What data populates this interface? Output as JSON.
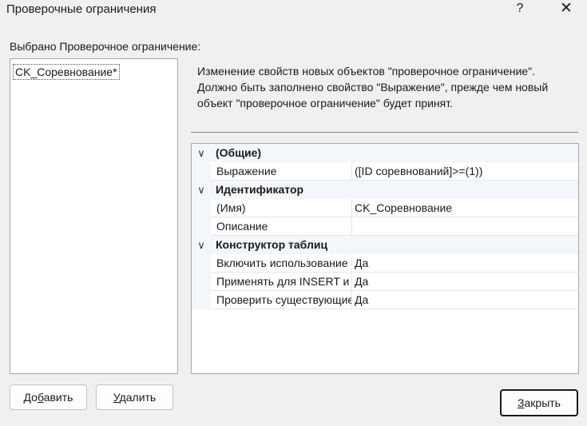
{
  "window": {
    "title": "Проверочные ограничения",
    "help_glyph": "?",
    "close_glyph": "✕"
  },
  "selection": {
    "label": "Выбрано Проверочное ограничение:",
    "items": [
      "CK_Соревнование*"
    ]
  },
  "description": "Изменение свойств новых объектов \"проверочное ограничение\". Должно быть заполнено свойство \"Выражение\", прежде чем новый объект \"проверочное ограничение\" будет принят.",
  "grid": {
    "categories": [
      {
        "label": "(Общие)",
        "properties": [
          {
            "name": "Выражение",
            "value": "([ID соревнований]>=(1))"
          }
        ]
      },
      {
        "label": "Идентификатор",
        "properties": [
          {
            "name": "(Имя)",
            "value": "CK_Соревнование"
          },
          {
            "name": "Описание",
            "value": ""
          }
        ]
      },
      {
        "label": "Конструктор таблиц",
        "properties": [
          {
            "name": "Включить использование",
            "value": "Да"
          },
          {
            "name": "Применять для INSERT и UPDATE",
            "value": "Да"
          },
          {
            "name": "Проверить существующие данные",
            "value": "Да"
          }
        ]
      }
    ],
    "expand_glyph": "∨"
  },
  "buttons": {
    "add": {
      "pre": "До",
      "acc": "б",
      "post": "авить"
    },
    "delete": {
      "pre": "",
      "acc": "У",
      "post": "далить"
    },
    "close": {
      "pre": "",
      "acc": "З",
      "post": "акрыть"
    }
  }
}
